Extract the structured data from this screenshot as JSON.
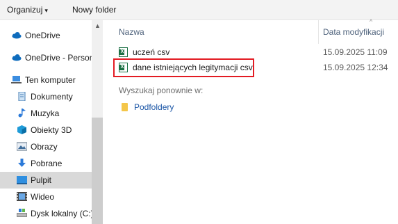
{
  "toolbar": {
    "organize": "Organizuj",
    "new_folder": "Nowy folder"
  },
  "nav": {
    "items": [
      {
        "label": "OneDrive",
        "icon": "cloud-icon"
      },
      {
        "label": "OneDrive - Person",
        "icon": "cloud-icon"
      },
      {
        "label": "Ten komputer",
        "icon": "computer-icon"
      },
      {
        "label": "Dokumenty",
        "icon": "documents-icon"
      },
      {
        "label": "Muzyka",
        "icon": "music-icon"
      },
      {
        "label": "Obiekty 3D",
        "icon": "3d-objects-icon"
      },
      {
        "label": "Obrazy",
        "icon": "pictures-icon"
      },
      {
        "label": "Pobrane",
        "icon": "downloads-icon"
      },
      {
        "label": "Pulpit",
        "icon": "desktop-icon"
      },
      {
        "label": "Wideo",
        "icon": "video-icon"
      },
      {
        "label": "Dysk lokalny (C:)",
        "icon": "drive-icon"
      }
    ],
    "selected": "Pulpit"
  },
  "columns": {
    "name": "Nazwa",
    "date": "Data modyfikacji"
  },
  "files": [
    {
      "name": "uczeń csv",
      "date": "15.09.2025 11:09"
    },
    {
      "name": "dane istniejących legitymacji csv",
      "date": "15.09.2025 12:34"
    }
  ],
  "search_again": {
    "label": "Wyszukaj ponownie w:",
    "subfolders": "Podfoldery"
  },
  "colors": {
    "highlight": "#e31b23",
    "excel": "#1d7145",
    "folder": "#f4c64a"
  }
}
